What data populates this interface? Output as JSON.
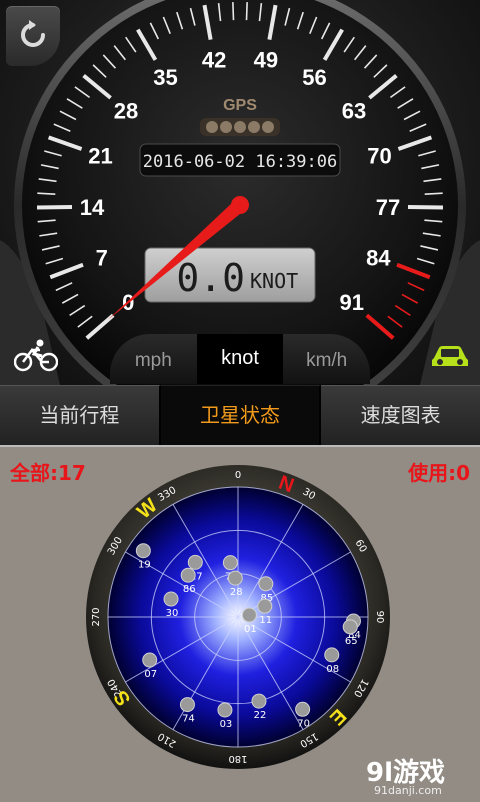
{
  "speedometer": {
    "ticks": [
      "0",
      "7",
      "14",
      "21",
      "28",
      "35",
      "42",
      "49",
      "56",
      "63",
      "70",
      "77",
      "84",
      "91"
    ],
    "brand": "GPS",
    "datetime": "2016-06-02 16:39:06",
    "speed_value": "0.0",
    "speed_unit": "KNOT",
    "speed": 0,
    "max_speed": 91,
    "needle_color": "#e81b1b",
    "redline_color": "#e81b1b"
  },
  "units": [
    {
      "label": "mph",
      "active": false
    },
    {
      "label": "knot",
      "active": true
    },
    {
      "label": "km/h",
      "active": false
    }
  ],
  "tabs": [
    {
      "label": "当前行程",
      "active": false
    },
    {
      "label": "卫星状态",
      "active": true
    },
    {
      "label": "速度图表",
      "active": false
    }
  ],
  "satellites": {
    "total_label": "全部:17",
    "used_label": "使用:0",
    "compass": {
      "N": "N",
      "E": "E",
      "S": "S",
      "W": "W"
    },
    "bearings": [
      "0",
      "30",
      "60",
      "90",
      "120",
      "150",
      "180",
      "210",
      "240",
      "270",
      "300",
      "330"
    ],
    "list": [
      {
        "id": "19",
        "az": 305,
        "el": 10
      },
      {
        "id": "17",
        "az": 322,
        "el": 42
      },
      {
        "id": "86",
        "az": 310,
        "el": 45
      },
      {
        "id": "76",
        "az": 352,
        "el": 52
      },
      {
        "id": "28",
        "az": 356,
        "el": 63
      },
      {
        "id": "85",
        "az": 40,
        "el": 60
      },
      {
        "id": "30",
        "az": 285,
        "el": 42
      },
      {
        "id": "01",
        "az": 80,
        "el": 82
      },
      {
        "id": "11",
        "az": 68,
        "el": 70
      },
      {
        "id": "84",
        "az": 92,
        "el": 10
      },
      {
        "id": "65",
        "az": 95,
        "el": 12
      },
      {
        "id": "07",
        "az": 244,
        "el": 22
      },
      {
        "id": "08",
        "az": 112,
        "el": 20
      },
      {
        "id": "74",
        "az": 210,
        "el": 20
      },
      {
        "id": "03",
        "az": 188,
        "el": 25
      },
      {
        "id": "22",
        "az": 166,
        "el": 30
      },
      {
        "id": "70",
        "az": 145,
        "el": 12
      }
    ]
  }
}
